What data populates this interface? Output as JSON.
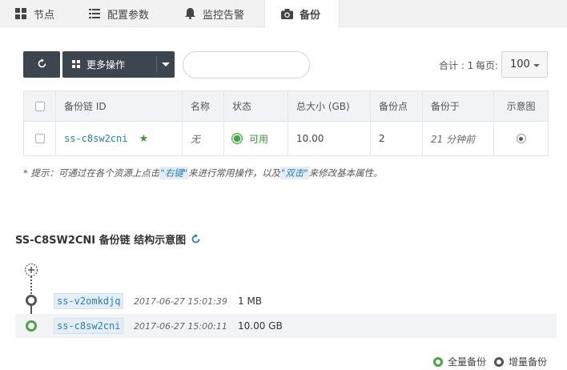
{
  "tabs": [
    {
      "label": "节点",
      "icon": "grid-icon"
    },
    {
      "label": "配置参数",
      "icon": "list-icon"
    },
    {
      "label": "监控告警",
      "icon": "bell-icon"
    },
    {
      "label": "备份",
      "icon": "camera-icon",
      "active": true
    }
  ],
  "toolbar": {
    "more_label": "更多操作",
    "search_placeholder": "",
    "total_label": "合计 : 1",
    "per_page_label": "每页:",
    "per_page_value": "100"
  },
  "table": {
    "headers": [
      "备份链 ID",
      "名称",
      "状态",
      "总大小 (GB)",
      "备份点",
      "备份于",
      "示意图"
    ],
    "rows": [
      {
        "id": "ss-c8sw2cni",
        "name": "无",
        "status": "可用",
        "size": "10.00",
        "points": "2",
        "time": "21 分钟前"
      }
    ]
  },
  "hint": {
    "prefix": "* 提示：可通过在各个资源上点击",
    "right_click": "\"右键\"",
    "middle": "来进行常用操作，以及",
    "double_click": "\"双击\"",
    "suffix": "来修改基本属性。"
  },
  "chain": {
    "title": "SS-C8SW2CNI 备份链 结构示意图",
    "items": [
      {
        "id": "ss-v2omkdjq",
        "time": "2017-06-27 15:01:39",
        "size": "1 MB",
        "type": "incremental"
      },
      {
        "id": "ss-c8sw2cni",
        "time": "2017-06-27 15:00:11",
        "size": "10.00 GB",
        "type": "full"
      }
    ]
  },
  "legend": {
    "full": "全量备份",
    "incremental": "增量备份"
  },
  "colors": {
    "accent": "#2c7bb8",
    "success": "#46a546",
    "dark_button": "#3c4550"
  }
}
